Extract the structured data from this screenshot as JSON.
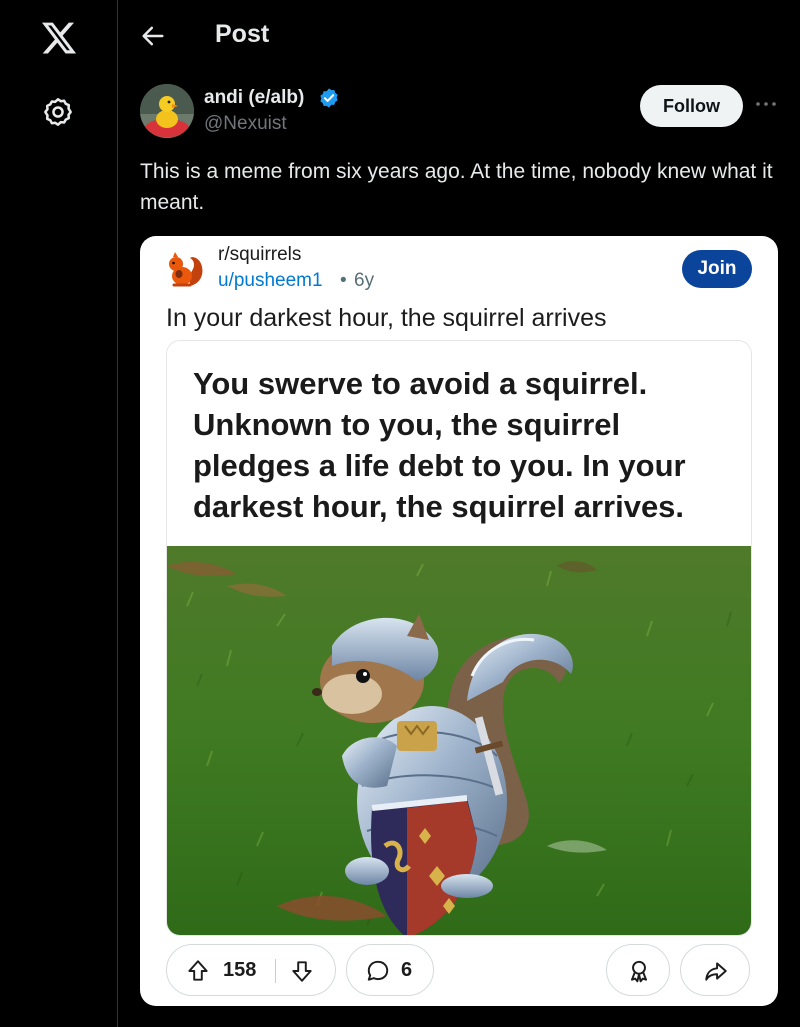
{
  "nav": {
    "logo_icon": "x-logo-icon",
    "settings_icon": "gear-icon"
  },
  "header": {
    "back_icon": "arrow-left-icon",
    "title": "Post"
  },
  "author": {
    "name": "andi (e/alb)",
    "handle": "@Nexuist",
    "verified_icon": "verified-badge-icon",
    "verified_color": "#1d9bf0",
    "follow_label": "Follow",
    "more_icon": "more-horizontal-icon"
  },
  "tweet": {
    "text": "This is a meme from six years ago. At the time, nobody knew what it meant."
  },
  "embed": {
    "subreddit": "r/squirrels",
    "user": "u/pusheem1",
    "separator": "•",
    "age": "6y",
    "join_label": "Join",
    "join_color": "#0a449b",
    "title": "In your darkest hour, the squirrel arrives",
    "meme_text": "You swerve to avoid a squirrel. Unknown to you, the squirrel pledges a life debt to you. In your darkest hour, the squirrel arrives.",
    "upvotes": "158",
    "comments": "6",
    "icons": {
      "upvote": "arrow-up-icon",
      "downvote": "arrow-down-icon",
      "comment": "comment-bubble-icon",
      "award": "award-icon",
      "share": "share-icon"
    }
  },
  "colors": {
    "background": "#000000",
    "text_primary": "#e7e9ea",
    "text_secondary": "#71767b",
    "link_blue": "#0079d3"
  }
}
